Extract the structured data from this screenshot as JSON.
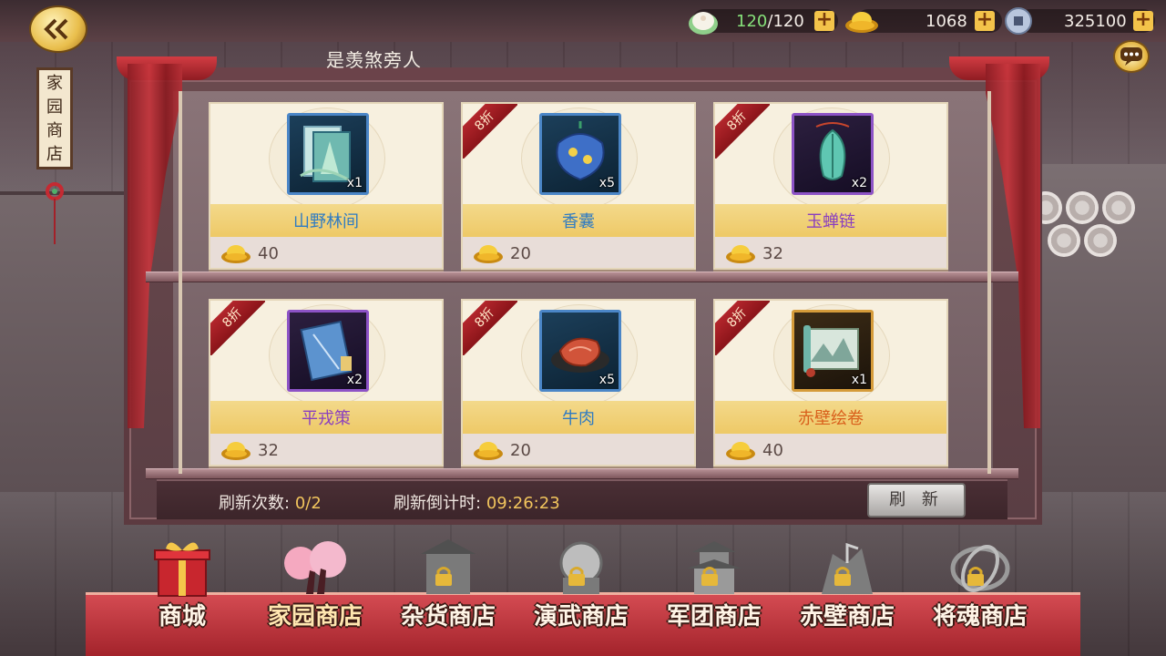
{
  "resources": {
    "stamina": {
      "icon": "bun-icon",
      "current": "120",
      "separator": "/",
      "max": "120"
    },
    "gold_ingot": {
      "icon": "gold-ingot-icon",
      "value": "1068"
    },
    "copper_coin": {
      "icon": "copper-coin-icon",
      "value": "325100"
    }
  },
  "shop": {
    "sign_chars": [
      "家",
      "园",
      "商",
      "店"
    ],
    "title": "是羡煞旁人",
    "items": [
      {
        "name": "山野林间",
        "qty": "x1",
        "price": "40",
        "discount": "",
        "rarity": "blue"
      },
      {
        "name": "香囊",
        "qty": "x5",
        "price": "20",
        "discount": "8折",
        "rarity": "blue"
      },
      {
        "name": "玉蝉链",
        "qty": "x2",
        "price": "32",
        "discount": "8折",
        "rarity": "purple"
      },
      {
        "name": "平戎策",
        "qty": "x2",
        "price": "32",
        "discount": "8折",
        "rarity": "purple"
      },
      {
        "name": "牛肉",
        "qty": "x5",
        "price": "20",
        "discount": "8折",
        "rarity": "blue"
      },
      {
        "name": "赤壁绘卷",
        "qty": "x1",
        "price": "40",
        "discount": "8折",
        "rarity": "orange"
      }
    ]
  },
  "refresh": {
    "count_label": "刷新次数:",
    "count_value": "0/2",
    "timer_label": "刷新倒计时:",
    "timer_value": "09:26:23",
    "button_label": "刷 新"
  },
  "tabs": [
    {
      "label": "商城",
      "locked": false,
      "active": false
    },
    {
      "label": "家园商店",
      "locked": false,
      "active": true
    },
    {
      "label": "杂货商店",
      "locked": true,
      "active": false
    },
    {
      "label": "演武商店",
      "locked": true,
      "active": false
    },
    {
      "label": "军团商店",
      "locked": true,
      "active": false
    },
    {
      "label": "赤壁商店",
      "locked": true,
      "active": false
    },
    {
      "label": "将魂商店",
      "locked": true,
      "active": false
    }
  ],
  "colors": {
    "name_blue": "#2f7bc2",
    "name_purple": "#8a3fbf",
    "name_orange": "#d9601c",
    "discount_ribbon": "#b3262c",
    "tab_bar": "#c43a42"
  }
}
